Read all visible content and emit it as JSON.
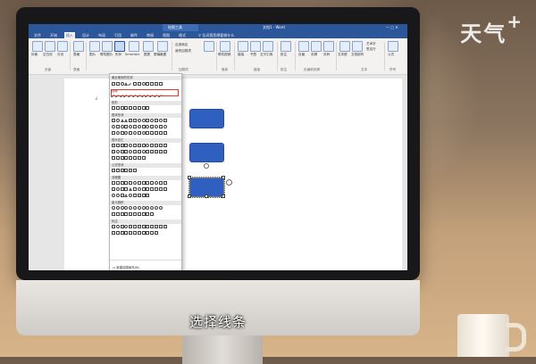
{
  "watermark": {
    "text": "天气",
    "plus": "+"
  },
  "subtitle": "选择线条",
  "word": {
    "title": "文档1 - Word",
    "context_tab": "绘图工具",
    "tabs": [
      "文件",
      "开始",
      "插入",
      "设计",
      "布局",
      "引用",
      "邮件",
      "审阅",
      "视图",
      "格式"
    ],
    "active_tab": "插入",
    "search_hint": "告诉我您想要做什么",
    "ribbon_buttons": [
      "封面",
      "空白页",
      "分页",
      "表格",
      "图片",
      "联机图片",
      "形状",
      "SmartArt",
      "图表",
      "屏幕截图",
      "应用商店",
      "我的加载项",
      "Wikipedia",
      "联机视频",
      "链接",
      "书签",
      "交叉引用",
      "批注",
      "页眉",
      "页脚",
      "页码",
      "文本框",
      "文档部件",
      "艺术字",
      "首字下沉",
      "签名行",
      "日期和时间",
      "对象",
      "公式",
      "符号",
      "编号"
    ],
    "ribbon_groups": [
      "页面",
      "表格",
      "加载项",
      "媒体",
      "链接",
      "批注",
      "页眉和页脚",
      "文本",
      "符号"
    ]
  },
  "shapes_menu": {
    "sections": [
      "最近使用的形状",
      "线条",
      "矩形",
      "基本形状",
      "箭头总汇",
      "公式形状",
      "流程图",
      "星与旗帜",
      "标注"
    ],
    "footer": "新建绘图画布(N)"
  }
}
